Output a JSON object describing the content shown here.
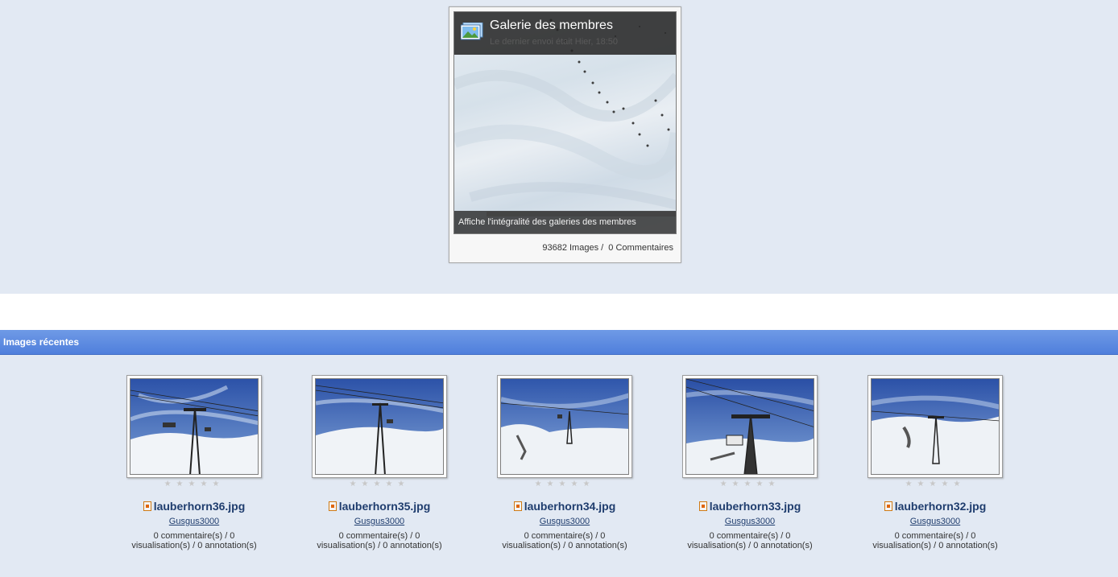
{
  "gallery": {
    "title": "Galerie des membres",
    "subtitle": "Le dernier envoi était Hier, 18:50",
    "caption": "Affiche l'intégralité des galeries des membres",
    "stats": "93682 Images /  0 Commentaires"
  },
  "recent": {
    "section_title": "Images récentes",
    "items": [
      {
        "filename": "lauberhorn36.jpg",
        "author": "Gusgus3000",
        "meta_line1": "0 commentaire(s) / 0",
        "meta_line2": "visualisation(s) / 0 annotation(s)",
        "rating": 0
      },
      {
        "filename": "lauberhorn35.jpg",
        "author": "Gusgus3000",
        "meta_line1": "0 commentaire(s) / 0",
        "meta_line2": "visualisation(s) / 0 annotation(s)",
        "rating": 0
      },
      {
        "filename": "lauberhorn34.jpg",
        "author": "Gusgus3000",
        "meta_line1": "0 commentaire(s) / 0",
        "meta_line2": "visualisation(s) / 0 annotation(s)",
        "rating": 0
      },
      {
        "filename": "lauberhorn33.jpg",
        "author": "Gusgus3000",
        "meta_line1": "0 commentaire(s) / 0",
        "meta_line2": "visualisation(s) / 0 annotation(s)",
        "rating": 0
      },
      {
        "filename": "lauberhorn32.jpg",
        "author": "Gusgus3000",
        "meta_line1": "0 commentaire(s) / 0",
        "meta_line2": "visualisation(s) / 0 annotation(s)",
        "rating": 0
      }
    ]
  },
  "colors": {
    "page_bg": "#e2e9f3",
    "section_bar": "#5b88e0",
    "link": "#1f3d6e"
  },
  "icons": {
    "gallery": "photo-gallery-icon",
    "file": "image-file-icon",
    "star": "star-icon"
  }
}
